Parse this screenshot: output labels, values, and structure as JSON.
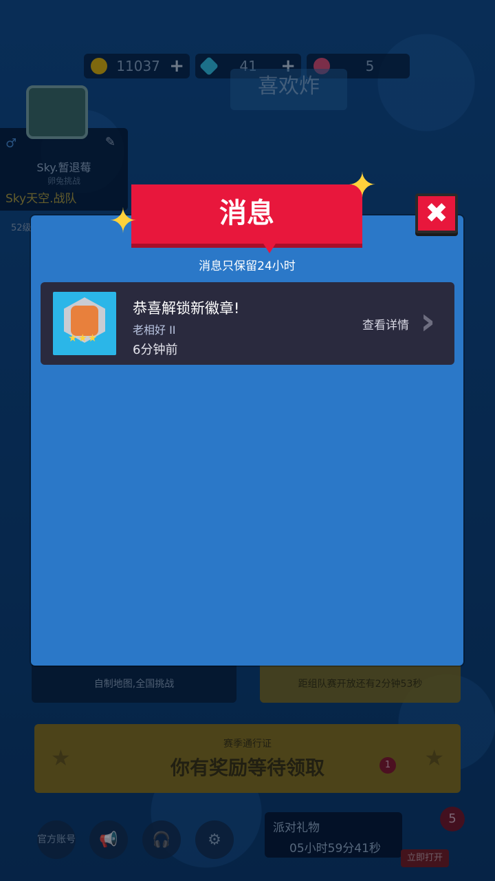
{
  "currency": {
    "coins": "11037",
    "gems": "41",
    "tickets": "5",
    "plus": "+"
  },
  "background": {
    "title": "喜欢炸",
    "profile": {
      "name": "Sky.暂退莓",
      "subtitle": "卵兔挑战",
      "team": "Sky天空.战队",
      "level": "52级"
    },
    "card_left_caption": "自制地图,全国挑战",
    "card_right_caption": "距组队赛开放还有2分钟53秒",
    "pass": {
      "title": "赛季通行证",
      "message": "你有奖励等待领取",
      "badge": "1"
    },
    "bottom": {
      "official_label": "官方账号",
      "gift_label": "派对礼物",
      "gift_timer": "05小时59分41秒",
      "open_now": "立即打开",
      "gift_count": "5"
    }
  },
  "modal": {
    "title": "消息",
    "subtitle": "消息只保留24小时",
    "messages": [
      {
        "title": "恭喜解锁新徽章!",
        "sender": "老相好 II",
        "time": "6分钟前",
        "action": "查看详情"
      }
    ]
  },
  "colors": {
    "modal_bg": "#2b78c8",
    "ribbon": "#e8173c",
    "row_bg": "#2a2a3e",
    "sparkle": "#ffd23c"
  },
  "icons": {
    "close": "close-icon",
    "arrow": "chevron-right-icon"
  }
}
